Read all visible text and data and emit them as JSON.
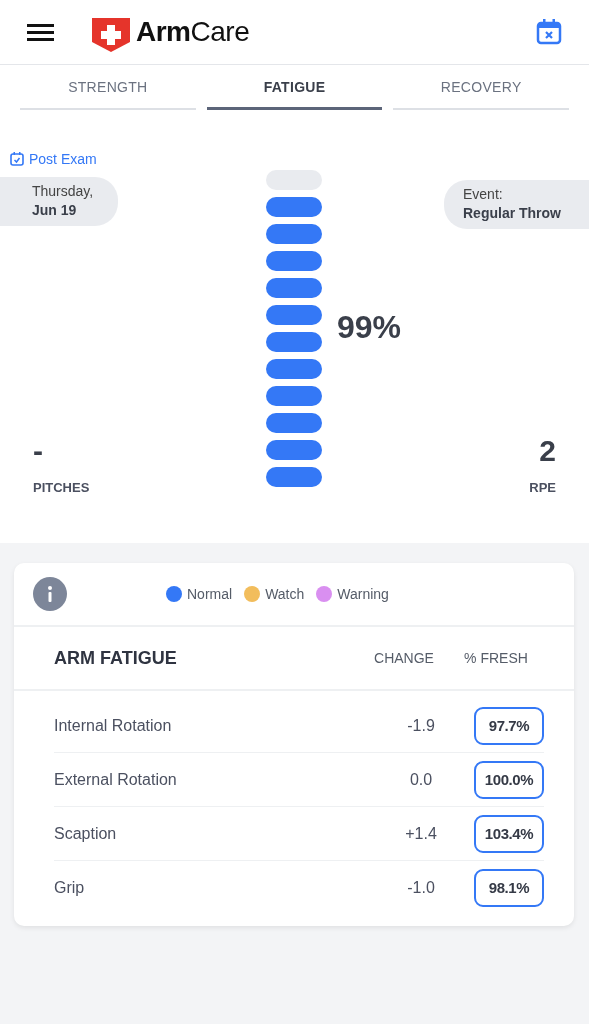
{
  "header": {
    "logo": "**Arm**Care"
  },
  "tabs": [
    {
      "label": "STRENGTH",
      "selected": false
    },
    {
      "label": "FATIGUE",
      "selected": true
    },
    {
      "label": "RECOVERY",
      "selected": false
    }
  ],
  "summary": {
    "exam_label": "Post Exam",
    "date_line_1": "Thursday,",
    "date_line_2": "Jun 19",
    "event_label": "Event:",
    "event_value": "Regular Throw",
    "gauge": {
      "segments": [
        {
          "filled": false
        },
        {
          "filled": true
        },
        {
          "filled": true
        },
        {
          "filled": true
        },
        {
          "filled": true
        },
        {
          "filled": true
        },
        {
          "filled": true
        },
        {
          "filled": true
        },
        {
          "filled": true
        },
        {
          "filled": true
        },
        {
          "filled": true
        },
        {
          "filled": true
        }
      ],
      "reading": "99%"
    },
    "pitches_value": "-",
    "pitches_label": "PITCHES",
    "rpe_value": "2",
    "rpe_label": "RPE"
  },
  "legend": [
    {
      "label": "Normal",
      "color": "#3478f6"
    },
    {
      "label": "Watch",
      "color": "#f2bd5c"
    },
    {
      "label": "Warning",
      "color": "#d98ff0"
    }
  ],
  "table": {
    "title": "ARM FATIGUE",
    "columns": [
      "CHANGE",
      "% FRESH"
    ],
    "rows": [
      {
        "name": "Internal Rotation",
        "change": "-1.9",
        "fresh": "97.7%",
        "color": "#3478f6"
      },
      {
        "name": "External Rotation",
        "change": "0.0",
        "fresh": "100.0%",
        "color": "#3478f6"
      },
      {
        "name": "Scaption",
        "change": "+1.4",
        "fresh": "103.4%",
        "color": "#3478f6"
      },
      {
        "name": "Grip",
        "change": "-1.0",
        "fresh": "98.1%",
        "color": "#3478f6"
      }
    ]
  }
}
